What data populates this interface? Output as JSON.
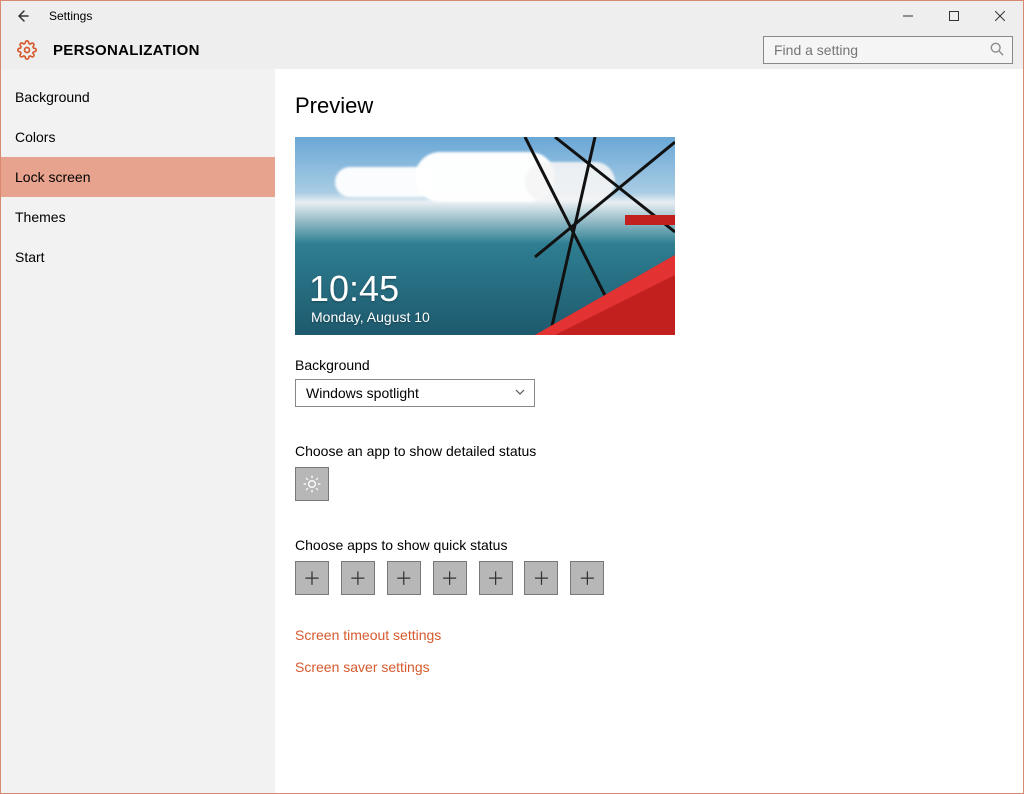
{
  "titlebar": {
    "title": "Settings"
  },
  "header": {
    "section": "PERSONALIZATION",
    "search_placeholder": "Find a setting"
  },
  "sidebar": {
    "items": [
      {
        "label": "Background",
        "selected": false
      },
      {
        "label": "Colors",
        "selected": false
      },
      {
        "label": "Lock screen",
        "selected": true
      },
      {
        "label": "Themes",
        "selected": false
      },
      {
        "label": "Start",
        "selected": false
      }
    ]
  },
  "content": {
    "heading": "Preview",
    "preview": {
      "time": "10:45",
      "date": "Monday, August 10"
    },
    "background_label": "Background",
    "background_value": "Windows spotlight",
    "detailed_label": "Choose an app to show detailed status",
    "detailed_app_icon": "weather-sun-icon",
    "quick_label": "Choose apps to show quick status",
    "quick_slots": 7,
    "links": [
      "Screen timeout settings",
      "Screen saver settings"
    ]
  }
}
